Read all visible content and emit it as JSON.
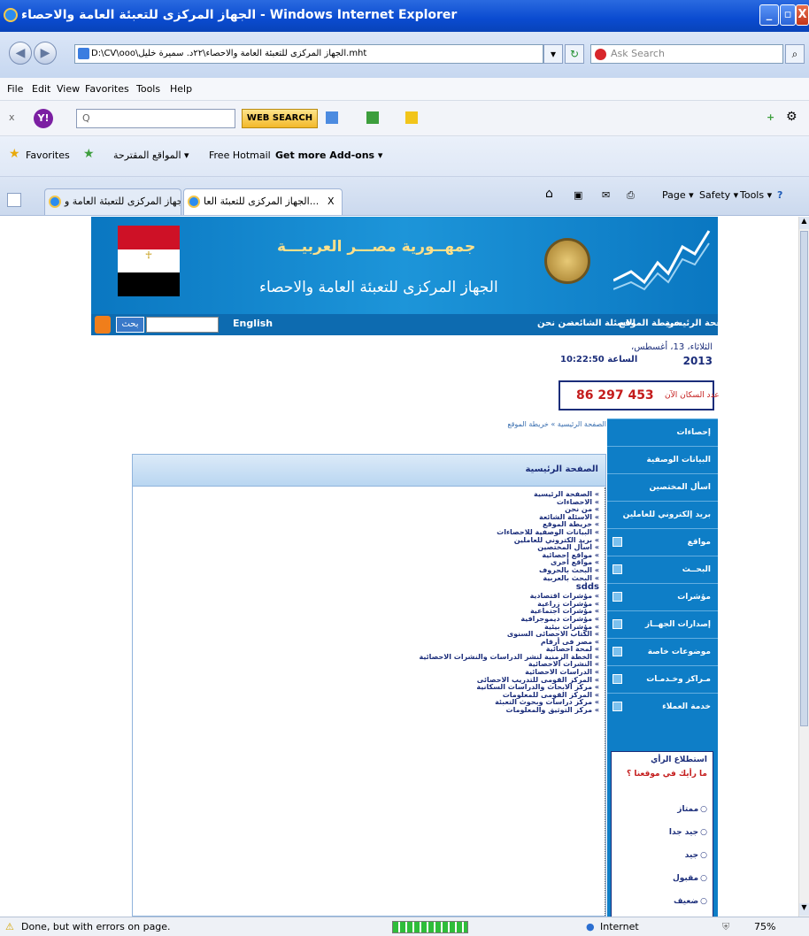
{
  "window": {
    "title": "الجهاز المركزى للتعبئة العامة والاحصاء - Windows Internet Explorer",
    "min": "_",
    "max": "▫",
    "close": "X"
  },
  "address": {
    "url": "D:\\CV\\ooo\\الجهاز المركزى للتعبئة العامة والاحصاء\\٢٢د. سميرة خليل.mht",
    "search_placeholder": "Ask Search"
  },
  "menu": [
    "File",
    "Edit",
    "View",
    "Favorites",
    "Tools",
    "Help"
  ],
  "yahoo": {
    "close": "x",
    "search_placeholder": "Q",
    "web_search": "WEB SEARCH"
  },
  "favorites": {
    "label": "Favorites",
    "items": [
      "المواقع المقترحة ▾",
      "Free Hotmail",
      "Get more Add-ons ▾"
    ]
  },
  "tabs": [
    {
      "label": "الجهاز المركزى للتعبئة العامة و..."
    },
    {
      "label": "الجهاز المركزى للتعبئة العا...",
      "close": "X"
    }
  ],
  "commands": [
    "Page ▾",
    "Safety ▾",
    "Tools ▾"
  ],
  "site": {
    "republic": "جمهــورية مصـــر العربيـــة",
    "agency": "الجهاز المركزى للتعبئة العامة والاحصاء",
    "nav_links": [
      "الصفحة الرئيسية",
      "خريطة الموقع",
      "الاسئلة الشائعة",
      "من نحن"
    ],
    "english": "English",
    "search_button": "بحث",
    "date": "الثلاثاء، 13، أغسطس،",
    "year": "2013",
    "time_label": "الساعة",
    "time": "10:22:50",
    "population_label": "عدد السكان الآن",
    "population": "86 297 453",
    "breadcrumb": "الصفحة الرئيسية » خريطة الموقع",
    "side_menu": [
      "إحصاءات",
      "البيانات الوصفية",
      "اسأل المختصين",
      "بريد إلكتروني للعاملين",
      "مواقع",
      "البحــث",
      "مؤشرات",
      "إصدارات الجهــاز",
      "موضوعات خاصة",
      "مـراكز وخـدمـات",
      "خدمة العملاء"
    ],
    "poll": {
      "title": "استطلاع الرأي",
      "question": "ما رأيك في موقعنا ؟",
      "options": [
        "ممتاز",
        "جيد جدا",
        "جيد",
        "مقبول",
        "ضعيف"
      ]
    },
    "home_title": "الصفحة الرئيسية",
    "links": [
      "» الصفحة الرئيسية",
      "» الاحصاءات",
      "» من نحن",
      "» الاسئلة الشائعة",
      "» خريطة الموقع",
      "» البيانات الوصفية للاحصاءات",
      "» بريد الكتروني للعاملين",
      "» اسأل المختصين",
      "» مواقع احصائية",
      "» مواقع أخرى",
      "» البحث بالحروف",
      "» البحث بالعربية",
      "sdds",
      "» مؤشرات اقتصادية",
      "» مؤشرات زراعية",
      "» مؤشرات اجتماعية",
      "» مؤشرات ديموجرافية",
      "» مؤشرات بيئية",
      "» الكتاب الاحصائى السنوى",
      "» مصر فى أرقام",
      "» لمحة احصائية",
      "» الخطة الزمنية لنشر الدراسات والنشرات الاحصائية",
      "» النشرات الاحصائية",
      "» الدراسات الاحصائية",
      "» المركز القومى للتدريب الاحصائى",
      "» مركز الابحاث والدراسات السكانية",
      "» المركز القومى للمعلومات",
      "» مركز دراسات وبحوث التعبئة",
      "» مركز التوثيق والمعلومات"
    ]
  },
  "status": {
    "text": "Done, but with errors on page.",
    "zone": "Internet",
    "zoom": "75%"
  }
}
